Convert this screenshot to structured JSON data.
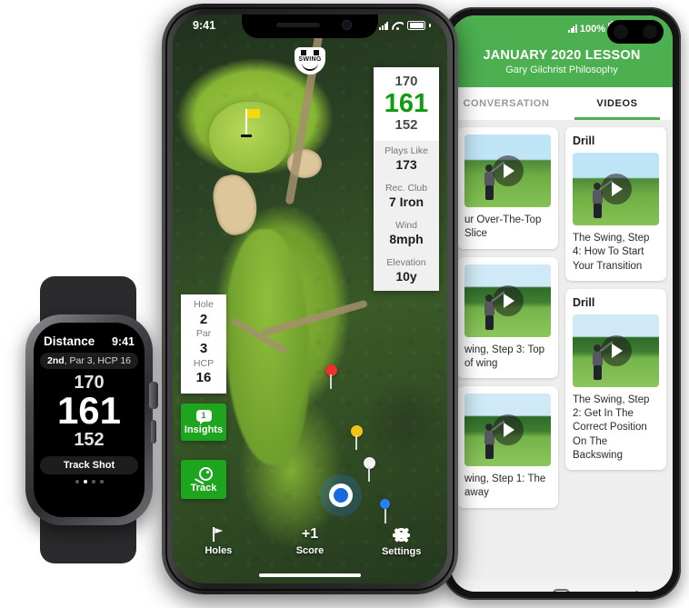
{
  "android": {
    "status": {
      "battery": "100%",
      "signal_icon": "signal-bars-icon",
      "battery_icon": "battery-icon"
    },
    "header": {
      "title": "JANUARY 2020 LESSON",
      "subtitle": "Gary Gilchrist Philosophy"
    },
    "tabs": [
      {
        "label": "CONVERSATION",
        "active": false
      },
      {
        "label": "VIDEOS",
        "active": true
      }
    ],
    "videos_left": [
      {
        "badge": "",
        "title": "ur Over-The-Top Slice"
      },
      {
        "badge": "",
        "title": "wing, Step 3: Top of wing"
      },
      {
        "badge": "",
        "title": "wing, Step 1: The away"
      }
    ],
    "videos_right": [
      {
        "badge": "Drill",
        "title": "The Swing, Step 4: How To Start Your Transition"
      },
      {
        "badge": "Drill",
        "title": "The Swing, Step 2: Get In The Correct Position On The Backswing"
      }
    ],
    "navbar": [
      {
        "name": "recents",
        "icon": "recents-icon"
      },
      {
        "name": "home",
        "icon": "home-icon"
      },
      {
        "name": "back",
        "icon": "back-icon"
      }
    ],
    "colors": {
      "header_green": "#4caf50",
      "body_gray": "#eeeeee"
    }
  },
  "iphone": {
    "status": {
      "time": "9:41",
      "signal_icon": "signal-bars-icon",
      "wifi_icon": "wifi-icon",
      "battery_icon": "battery-icon"
    },
    "logo": {
      "word": "SWING"
    },
    "distance_card": {
      "far": "170",
      "main": "161",
      "near": "152",
      "main_color": "#0f9d10",
      "rows": [
        {
          "key": "Plays Like",
          "value": "173"
        },
        {
          "key": "Rec. Club",
          "value": "7 Iron"
        },
        {
          "key": "Wind",
          "value": "8mph"
        },
        {
          "key": "Elevation",
          "value": "10y"
        }
      ]
    },
    "hole_card": [
      {
        "key": "Hole",
        "value": "2"
      },
      {
        "key": "Par",
        "value": "3"
      },
      {
        "key": "HCP",
        "value": "16"
      }
    ],
    "side_buttons": [
      {
        "label": "Insights",
        "badge": "1",
        "icon": "speech-bubble-icon"
      },
      {
        "label": "Track",
        "badge": "",
        "icon": "shot-track-icon"
      }
    ],
    "tabbar": [
      {
        "label": "Holes",
        "icon": "flag-icon",
        "value": ""
      },
      {
        "label": "Score",
        "icon": "",
        "value": "+1"
      },
      {
        "label": "Settings",
        "icon": "gear-icon",
        "value": ""
      }
    ],
    "map": {
      "pins": [
        {
          "name": "red-pin",
          "color": "#e8332a"
        },
        {
          "name": "yellow-pin",
          "color": "#f2c316"
        },
        {
          "name": "white-pin",
          "color": "#f2f2f2"
        },
        {
          "name": "blue-pin",
          "color": "#2a7ef0"
        }
      ],
      "my_location_color": "#1769e0",
      "flag_color": "#f5d90a"
    }
  },
  "watch": {
    "title": "Distance",
    "time": "9:41",
    "hole_pill_bold": "2nd",
    "hole_pill_rest": ", Par 3, HCP 16",
    "far": "170",
    "main": "161",
    "near": "152",
    "action_label": "Track Shot",
    "page_dots": 4,
    "active_dot": 2
  }
}
